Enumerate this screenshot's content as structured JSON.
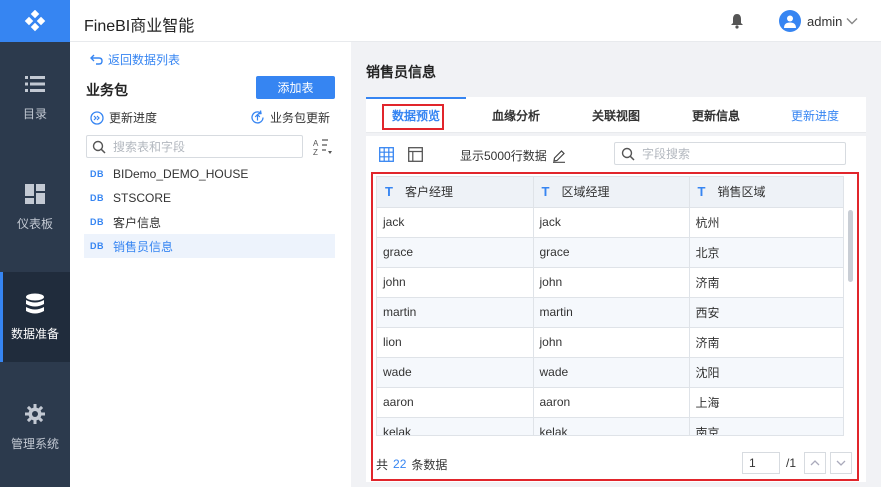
{
  "app": {
    "title": "FineBI商业智能"
  },
  "user": {
    "name": "admin"
  },
  "nav": {
    "items": [
      {
        "label": "目录",
        "icon": "list-icon"
      },
      {
        "label": "仪表板",
        "icon": "dashboard-icon"
      },
      {
        "label": "数据准备",
        "icon": "database-icon",
        "active": true
      },
      {
        "label": "管理系统",
        "icon": "gear-icon"
      }
    ]
  },
  "package": {
    "back_label": "返回数据列表",
    "title": "业务包",
    "add_table_label": "添加表",
    "update_progress_label": "更新进度",
    "package_update_label": "业务包更新",
    "search_placeholder": "搜索表和字段",
    "tables": [
      {
        "icon": "DB",
        "name": "BIDemo_DEMO_HOUSE"
      },
      {
        "icon": "DB",
        "name": "STSCORE"
      },
      {
        "icon": "DB",
        "name": "客户信息"
      },
      {
        "icon": "DB",
        "name": "销售员信息",
        "selected": true
      }
    ]
  },
  "detail": {
    "title": "销售员信息",
    "tabs": [
      "数据预览",
      "血缘分析",
      "关联视图",
      "更新信息"
    ],
    "update_progress_link": "更新进度",
    "rows_label": "显示5000行数据",
    "field_search_placeholder": "字段搜索",
    "columns": [
      {
        "type": "T",
        "name": "客户经理"
      },
      {
        "type": "T",
        "name": "区域经理"
      },
      {
        "type": "T",
        "name": "销售区域"
      }
    ],
    "rows": [
      [
        "jack",
        "jack",
        "杭州"
      ],
      [
        "grace",
        "grace",
        "北京"
      ],
      [
        "john",
        "john",
        "济南"
      ],
      [
        "martin",
        "martin",
        "西安"
      ],
      [
        "lion",
        "john",
        "济南"
      ],
      [
        "wade",
        "wade",
        "沈阳"
      ],
      [
        "aaron",
        "aaron",
        "上海"
      ],
      [
        "kelak",
        "kelak",
        "南京"
      ]
    ],
    "footer": {
      "prefix": "共",
      "count": "22",
      "suffix": "条数据",
      "page": "1",
      "total_pages": "/1"
    }
  },
  "colors": {
    "accent": "#3685f2",
    "nav_bg": "#2c3a4d",
    "highlight": "#e1252b"
  }
}
